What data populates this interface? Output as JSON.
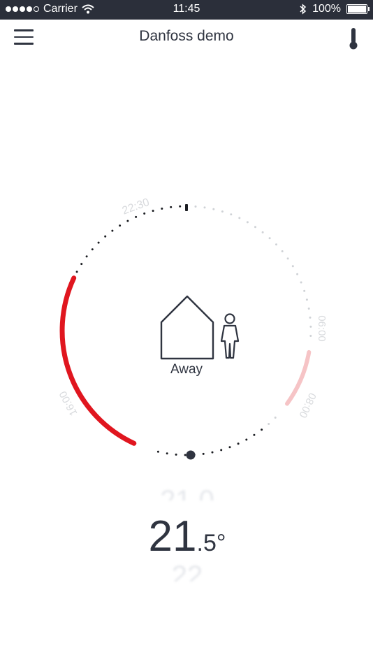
{
  "status_bar": {
    "carrier": "Carrier",
    "time": "11:45",
    "battery": "100%"
  },
  "nav": {
    "title": "Danfoss demo",
    "menu_icon": "menu-icon",
    "right_icon": "thermometer-icon"
  },
  "dial": {
    "mode_label": "Away",
    "times": {
      "top": "22:30",
      "right_top": "06:00",
      "right_bottom": "08:00",
      "left": "16:00"
    },
    "colors": {
      "active": "#e0161f",
      "inactive_segment": "#f6c4c6",
      "dots_dark": "#1b1d22",
      "dots_light": "#cfd2d6"
    }
  },
  "temperature": {
    "integer": "21",
    "decimal": ".5°",
    "ghost_above": "21.0",
    "ghost_below": "22"
  }
}
